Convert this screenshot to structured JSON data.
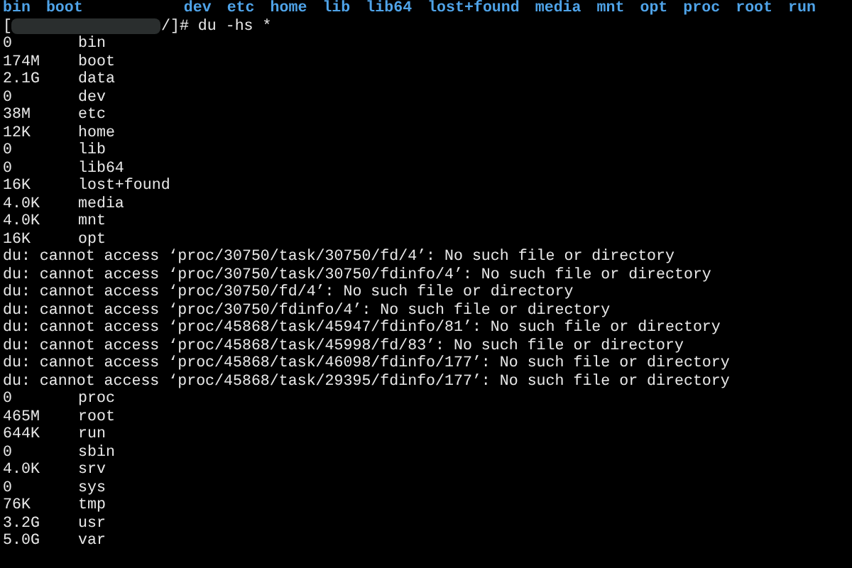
{
  "ls_line": [
    "bin",
    "boot",
    "dev",
    "etc",
    "home",
    "lib",
    "lib64",
    "lost+found",
    "media",
    "mnt",
    "opt",
    "proc",
    "root",
    "run"
  ],
  "prompt": {
    "open": "[",
    "command": "/]# du -hs *"
  },
  "output": [
    {
      "kind": "size",
      "size": "0",
      "name": "bin"
    },
    {
      "kind": "size",
      "size": "174M",
      "name": "boot"
    },
    {
      "kind": "size",
      "size": "2.1G",
      "name": "data"
    },
    {
      "kind": "size",
      "size": "0",
      "name": "dev"
    },
    {
      "kind": "size",
      "size": "38M",
      "name": "etc"
    },
    {
      "kind": "size",
      "size": "12K",
      "name": "home"
    },
    {
      "kind": "size",
      "size": "0",
      "name": "lib"
    },
    {
      "kind": "size",
      "size": "0",
      "name": "lib64"
    },
    {
      "kind": "size",
      "size": "16K",
      "name": "lost+found"
    },
    {
      "kind": "size",
      "size": "4.0K",
      "name": "media"
    },
    {
      "kind": "size",
      "size": "4.0K",
      "name": "mnt"
    },
    {
      "kind": "size",
      "size": "16K",
      "name": "opt"
    },
    {
      "kind": "error",
      "text": "du: cannot access ‘proc/30750/task/30750/fd/4’: No such file or directory"
    },
    {
      "kind": "error",
      "text": "du: cannot access ‘proc/30750/task/30750/fdinfo/4’: No such file or directory"
    },
    {
      "kind": "error",
      "text": "du: cannot access ‘proc/30750/fd/4’: No such file or directory"
    },
    {
      "kind": "error",
      "text": "du: cannot access ‘proc/30750/fdinfo/4’: No such file or directory"
    },
    {
      "kind": "error",
      "text": "du: cannot access ‘proc/45868/task/45947/fdinfo/81’: No such file or directory"
    },
    {
      "kind": "error",
      "text": "du: cannot access ‘proc/45868/task/45998/fd/83’: No such file or directory"
    },
    {
      "kind": "error",
      "text": "du: cannot access ‘proc/45868/task/46098/fdinfo/177’: No such file or directory"
    },
    {
      "kind": "error",
      "text": "du: cannot access ‘proc/45868/task/29395/fdinfo/177’: No such file or directory"
    },
    {
      "kind": "size",
      "size": "0",
      "name": "proc"
    },
    {
      "kind": "size",
      "size": "465M",
      "name": "root"
    },
    {
      "kind": "size",
      "size": "644K",
      "name": "run"
    },
    {
      "kind": "size",
      "size": "0",
      "name": "sbin"
    },
    {
      "kind": "size",
      "size": "4.0K",
      "name": "srv"
    },
    {
      "kind": "size",
      "size": "0",
      "name": "sys"
    },
    {
      "kind": "size",
      "size": "76K",
      "name": "tmp"
    },
    {
      "kind": "size",
      "size": "3.2G",
      "name": "usr"
    },
    {
      "kind": "size",
      "size": "5.0G",
      "name": "var"
    }
  ]
}
